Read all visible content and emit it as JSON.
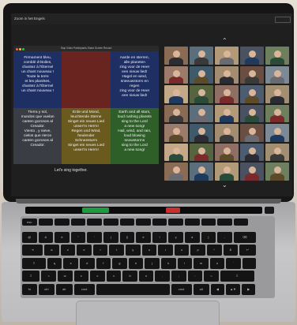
{
  "zoom_title": "Zoom in het Engels",
  "share_header": "Stop Video    Participants    Share Screen    Record",
  "caption": "Let's sing together.",
  "lyrics": [
    {
      "text": "Firmament bleu,\ncomblé d'étoiles,\nchantez à l'Éternel\nun chant nouveau !\nToute la terre\net les planètes,\nchantez à l'Éternel\nun chant nouveau !",
      "bg": "#1d2f63"
    },
    {
      "text": "",
      "bg": "#6a2420"
    },
    {
      "text": "Aarde en sterren,\nalle planeten\nzing voor de Heer\neen nieuw lied!\nHagel en wind,\nsneeuwstorm  en\nregen\nzing voor de Heer\neen nieuw lied!",
      "bg": "#1d2f63"
    },
    {
      "text": "Tierra y sol,\nmundos que vuelan\ncanten gozosos al\nCreador.\nViento , y nieve,\ncielos que rieron\ncanten gozosos al\nCreador.",
      "bg": "#3a3d44"
    },
    {
      "text": "Erde und Mond,\nleuchtende Sterne\nSinget ein neues Lied\nunser'm Herrn!\nRegen und Wind,\nheulender\nSchneesturm\nSinget ein neues Lied\nunser'm Herrn!",
      "bg": "#6a5a1e"
    },
    {
      "text": "Earth and all stars,\nloud rushing planets\nsing to the Lord\na new song!\nHail, wind, and rain,\nloud blowing\nsnowstorms\nsing to the Lord\na new song!",
      "bg": "#2e5f29"
    }
  ],
  "touch_bar": {
    "green_label": "",
    "red_label": ""
  },
  "keyboard_rows": [
    [
      "esc",
      "",
      "",
      "",
      "",
      "",
      "",
      "",
      "",
      "",
      "",
      "",
      "",
      ""
    ],
    [
      "@",
      "&",
      "é",
      "\"",
      "'",
      "(",
      "§",
      "è",
      "!",
      "ç",
      "à",
      ")",
      "-",
      "⌫"
    ],
    [
      "⇥",
      "a",
      "z",
      "e",
      "r",
      "t",
      "y",
      "u",
      "i",
      "o",
      "p",
      "^",
      "$",
      "↩"
    ],
    [
      "⇪",
      "q",
      "s",
      "d",
      "f",
      "g",
      "h",
      "j",
      "k",
      "l",
      "m",
      "ù",
      "`",
      ""
    ],
    [
      "⇧",
      "<",
      "w",
      "x",
      "c",
      "v",
      "b",
      "n",
      ",",
      ";",
      ":",
      "=",
      "⇧"
    ],
    [
      "fn",
      "ctrl",
      "alt",
      "cmd",
      "",
      "cmd",
      "alt",
      "◀",
      "▲▼",
      "▶"
    ]
  ],
  "colors": {
    "tile_bgs": [
      "#8a6c55",
      "#5b6e7c",
      "#b29a78",
      "#4a5160",
      "#6d7f5c",
      "#9b7c6a",
      "#3f5a6b",
      "#a48c70",
      "#6a4e42",
      "#7d8a96",
      "#c4a988",
      "#56643f",
      "#8f6f63",
      "#4d5c6e",
      "#a28f72"
    ],
    "shirt_colors": [
      "#2c2c34",
      "#7a2a2a",
      "#1f3a5c",
      "#3a3a3a",
      "#5c4a2a",
      "#2a4a3a",
      "#6a6a72"
    ]
  }
}
